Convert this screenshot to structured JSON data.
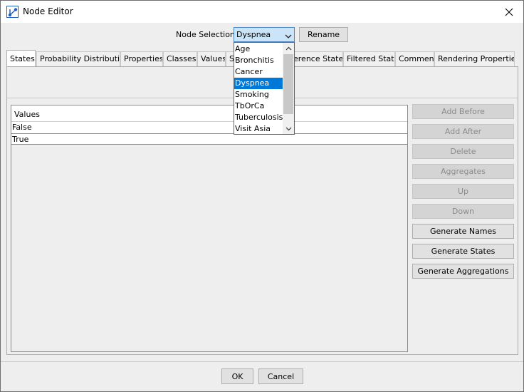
{
  "window": {
    "title": "Node Editor"
  },
  "selector": {
    "label": "Node Selection:",
    "value": "Dyspnea",
    "rename_label": "Rename",
    "options": [
      "Age",
      "Bronchitis",
      "Cancer",
      "Dyspnea",
      "Smoking",
      "TbOrCa",
      "Tuberculosis",
      "Visit Asia"
    ],
    "selected_index": 3
  },
  "tabs": [
    "States",
    "Probability Distribution",
    "Properties",
    "Classes",
    "Values",
    "S",
    "erence State",
    "Filtered State",
    "Comment",
    "Rendering Properties"
  ],
  "table": {
    "header": "Values",
    "rows": [
      "False",
      "True"
    ]
  },
  "side_buttons": {
    "add_before": "Add Before",
    "add_after": "Add After",
    "delete": "Delete",
    "aggregates": "Aggregates",
    "up": "Up",
    "down": "Down",
    "generate_names": "Generate Names",
    "generate_states": "Generate States",
    "generate_aggregations": "Generate Aggregations"
  },
  "footer": {
    "ok": "OK",
    "cancel": "Cancel"
  },
  "icons": {
    "app": "app-icon",
    "close": "close-icon",
    "combo_arrow": "chevron-down-icon",
    "scroll_up": "chevron-up-icon",
    "scroll_down": "chevron-down-icon"
  },
  "colors": {
    "selection": "#0078d7",
    "combo_bg": "#cce4f7"
  }
}
